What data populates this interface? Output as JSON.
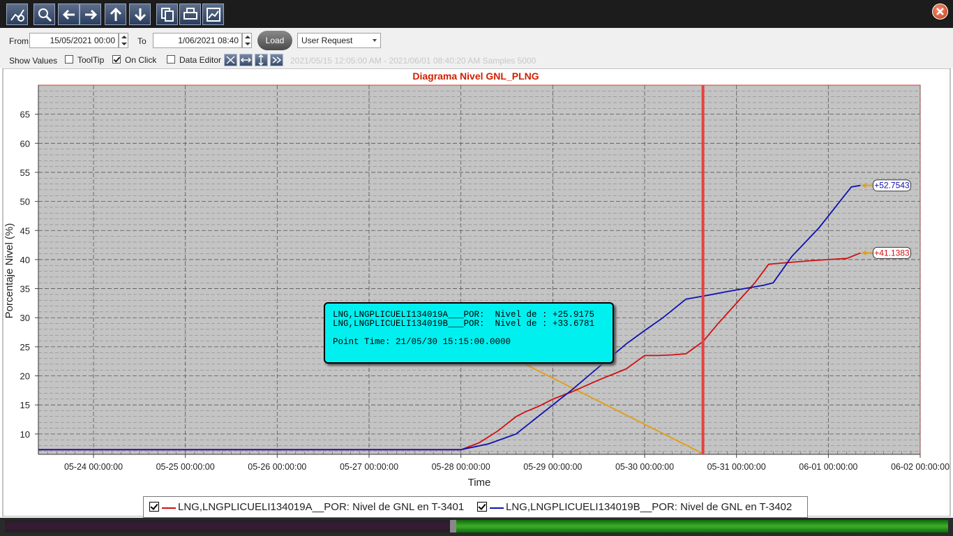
{
  "toolbar": {
    "icons": [
      "chart-settings-icon",
      "zoom-icon",
      "back-arrow-icon",
      "forward-arrow-icon",
      "up-arrow-icon",
      "download-icon",
      "copy-icon",
      "print-icon",
      "chart-export-icon"
    ],
    "close_icon": "close-icon"
  },
  "controls": {
    "from_label": "From",
    "from_value": "15/05/2021 00:00",
    "to_label": "To",
    "to_value": "1/06/2021 08:40",
    "load_label": "Load",
    "mode_value": "User Request",
    "show_values_label": "Show Values",
    "tooltip_label": "ToolTip",
    "tooltip_checked": false,
    "onclick_label": "On Click",
    "onclick_checked": true,
    "data_editor_label": "Data Editor",
    "data_editor_checked": false,
    "range_text": "2021/05/15 12:05:00 AM - 2021/06/01 08:40:20 AM  Samples 5000"
  },
  "tooltip": {
    "line1": "LNG,LNGPLICUELI134019A___POR:  Nivel de : +25.9175",
    "line2": "LNG,LNGPLICUELI134019B___POR:  Nivel de : +33.6781",
    "line3": "Point Time: 21/05/30 15:15:00.0000"
  },
  "chart_data": {
    "type": "line",
    "title": "Diagrama Nivel GNL_PLNG",
    "xlabel": "Time",
    "ylabel": "Porcentaje Nivel (%)",
    "xlim": [
      23.4,
      33.0
    ],
    "ylim": [
      6.5,
      70
    ],
    "xticks": [
      24,
      25,
      26,
      27,
      28,
      29,
      30,
      31,
      32,
      33
    ],
    "xtick_labels": [
      "05-24 00:00:00",
      "05-25 00:00:00",
      "05-26 00:00:00",
      "05-27 00:00:00",
      "05-28 00:00:00",
      "05-29 00:00:00",
      "05-30 00:00:00",
      "05-31 00:00:00",
      "06-01 00:00:00",
      "06-02 00:00:00"
    ],
    "yticks": [
      10,
      15,
      20,
      25,
      30,
      35,
      40,
      45,
      50,
      55,
      60,
      65
    ],
    "grid": true,
    "cursor_x": 30.635,
    "series": [
      {
        "name": "LNG,LNGPLICUELI134019A__POR:  Nivel de GNL en T-3401",
        "color": "#d01010",
        "last_value_label": "+41.1383",
        "x": [
          23.4,
          28.0,
          28.2,
          28.4,
          28.6,
          28.7,
          28.85,
          29.0,
          29.2,
          29.5,
          29.8,
          30.0,
          30.15,
          30.3,
          30.45,
          30.635,
          30.8,
          31.0,
          31.2,
          31.35,
          31.5,
          31.8,
          32.0,
          32.2,
          32.35
        ],
        "y": [
          7.3,
          7.3,
          8.5,
          10.5,
          13.0,
          13.8,
          14.8,
          16.0,
          17.2,
          19.3,
          21.2,
          23.5,
          23.5,
          23.6,
          23.8,
          25.9,
          29.0,
          32.5,
          36.0,
          39.2,
          39.4,
          39.8,
          40.0,
          40.2,
          41.14
        ]
      },
      {
        "name": "LNG,LNGPLICUELI134019B__POR:  Nivel de GNL en T-3402",
        "color": "#1010b0",
        "last_value_label": "+52.7543",
        "x": [
          23.4,
          28.0,
          28.3,
          28.6,
          28.8,
          29.0,
          29.2,
          29.5,
          29.8,
          30.0,
          30.2,
          30.45,
          30.635,
          30.9,
          31.3,
          31.4,
          31.6,
          31.9,
          32.1,
          32.25,
          32.35
        ],
        "y": [
          7.3,
          7.3,
          8.3,
          10.0,
          12.5,
          15.0,
          17.5,
          21.5,
          25.5,
          27.8,
          30.0,
          33.2,
          33.7,
          34.5,
          35.6,
          36.0,
          40.5,
          45.5,
          49.5,
          52.5,
          52.75
        ]
      }
    ]
  },
  "legend": {
    "items": [
      {
        "label": "LNG,LNGPLICUELI134019A__POR:  Nivel de GNL en T-3401",
        "color": "#d01010"
      },
      {
        "label": "LNG,LNGPLICUELI134019B__POR:  Nivel de GNL en T-3402",
        "color": "#1010b0"
      }
    ]
  },
  "colors": {
    "title": "#d02000",
    "cursor": "#e84040",
    "tooltip_bg": "#00f0f0",
    "leader": "#e0a020"
  }
}
